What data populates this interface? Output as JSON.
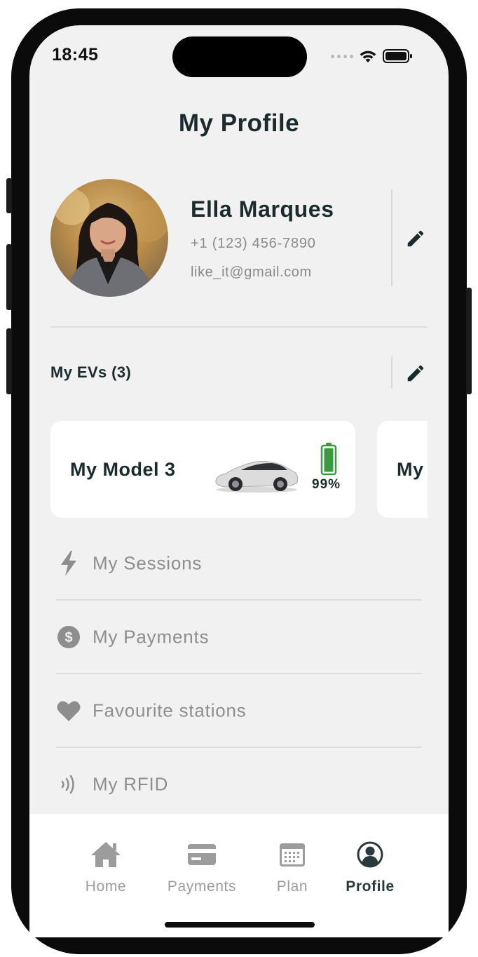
{
  "status_bar": {
    "time": "18:45"
  },
  "header": {
    "title": "My Profile"
  },
  "profile": {
    "name": "Ella Marques",
    "phone": "+1 (123) 456-7890",
    "email": "like_it@gmail.com"
  },
  "evs": {
    "title": "My EVs (3)",
    "cards": [
      {
        "name": "My Model 3",
        "battery": "99%",
        "battery_level": 0.99,
        "battery_color": "#3a9a3f"
      },
      {
        "name": "My"
      }
    ]
  },
  "menu": {
    "items": [
      {
        "label": "My Sessions",
        "icon": "lightning-icon"
      },
      {
        "label": "My Payments",
        "icon": "dollar-icon"
      },
      {
        "label": "Favourite stations",
        "icon": "heart-icon"
      },
      {
        "label": "My RFID",
        "icon": "rfid-icon"
      }
    ]
  },
  "tabbar": {
    "tabs": [
      {
        "label": "Home",
        "icon": "home-icon",
        "active": false
      },
      {
        "label": "Payments",
        "icon": "card-icon",
        "active": false
      },
      {
        "label": "Plan",
        "icon": "calendar-icon",
        "active": false
      },
      {
        "label": "Profile",
        "icon": "profile-icon",
        "active": true
      }
    ]
  },
  "colors": {
    "primary_text": "#1b2b2d",
    "secondary_text": "#8a8a8a",
    "background": "#f1f1f1",
    "battery_green": "#3a9a3f"
  }
}
